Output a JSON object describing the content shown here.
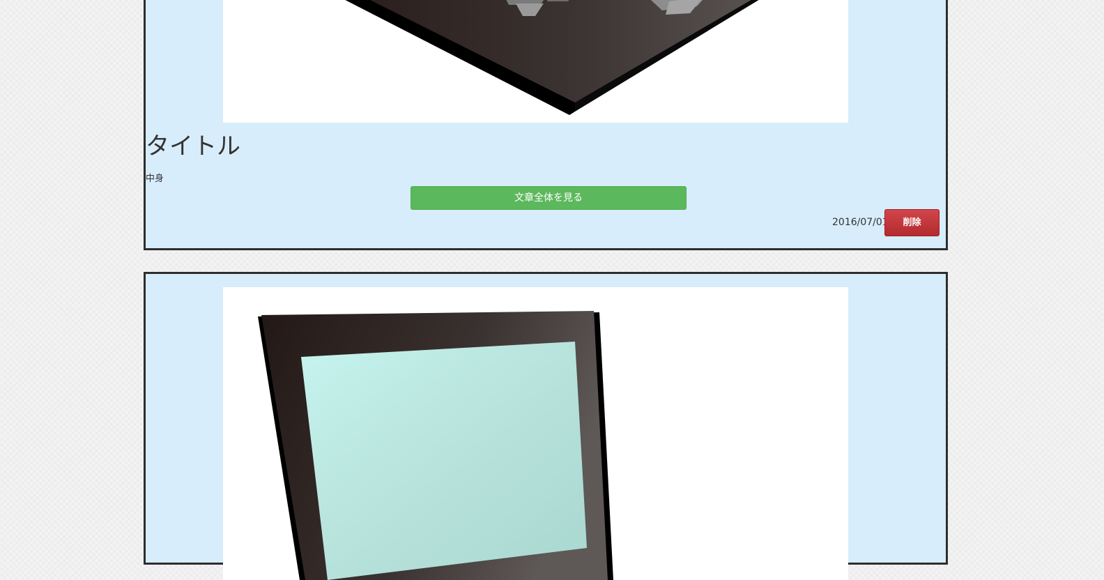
{
  "posts": [
    {
      "title": "タイトル",
      "body": "中身",
      "read_more_label": "文章全体を見る",
      "date": "2016/07/01",
      "delete_label": "削除",
      "image_icon": "laptop-keyboard-image"
    },
    {
      "image_icon": "laptop-screen-image"
    }
  ],
  "colors": {
    "card_background": "#d7edfb",
    "card_border": "#2e2e2e",
    "read_more_button": "#5cb85c",
    "delete_button": "#c9302c"
  }
}
